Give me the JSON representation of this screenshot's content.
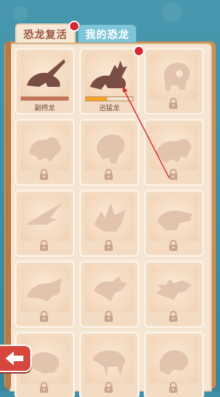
{
  "tabs": [
    {
      "label": "恐龙复活",
      "active": true,
      "has_badge": true
    },
    {
      "label": "我的恐龙",
      "active": false,
      "has_badge": false
    }
  ],
  "cards": [
    {
      "name": "副栉龙",
      "state": "complete",
      "shape": "parasaurolophus"
    },
    {
      "name": "迅猛龙",
      "state": "in-progress",
      "progress": 0.45,
      "shape": "raptor",
      "has_badge": true
    },
    {
      "name": "",
      "state": "locked",
      "shape": "round"
    },
    {
      "name": "",
      "state": "locked",
      "shape": "pachy"
    },
    {
      "name": "",
      "state": "locked",
      "shape": "round2"
    },
    {
      "name": "",
      "state": "locked",
      "shape": "trex"
    },
    {
      "name": "",
      "state": "locked",
      "shape": "ptero"
    },
    {
      "name": "",
      "state": "locked",
      "shape": "trike"
    },
    {
      "name": "",
      "state": "locked",
      "shape": "croc"
    },
    {
      "name": "",
      "state": "locked",
      "shape": "long"
    },
    {
      "name": "",
      "state": "locked",
      "shape": "bird"
    },
    {
      "name": "",
      "state": "locked",
      "shape": "spiky"
    },
    {
      "name": "",
      "state": "locked",
      "shape": "duck"
    },
    {
      "name": "",
      "state": "locked",
      "shape": "sabre"
    },
    {
      "name": "",
      "state": "locked",
      "shape": "ram"
    }
  ],
  "colors": {
    "background": "#3f8fa7",
    "page": "#f5e6d4",
    "bone_complete": "#7a4e45",
    "bone_locked": "#e2c3ad",
    "accent_badge": "#d8262e",
    "progress": "#f5a623",
    "back_button": "#d6463d"
  },
  "icons": {
    "lock": "padlock-icon",
    "back": "back-arrow-icon"
  }
}
